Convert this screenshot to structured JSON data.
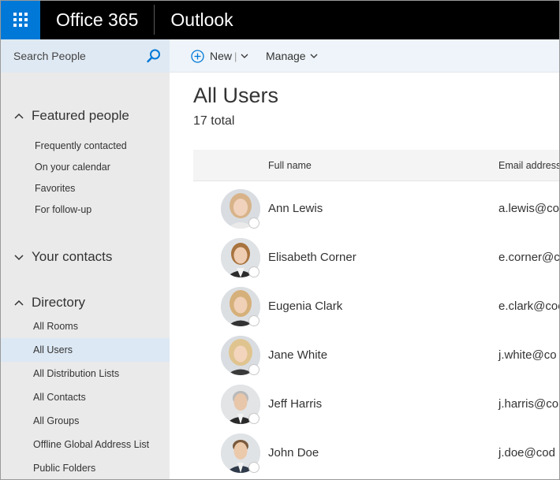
{
  "header": {
    "brand": "Office 365",
    "app": "Outlook"
  },
  "commandbar": {
    "search_placeholder": "Search People",
    "new_label": "New",
    "manage_label": "Manage"
  },
  "sidebar": {
    "featured_header": "Featured people",
    "featured_items": [
      "Frequently contacted",
      "On your calendar",
      "Favorites",
      "For follow-up"
    ],
    "contacts_header": "Your contacts",
    "directory_header": "Directory",
    "directory_items": [
      "All Rooms",
      "All Users",
      "All Distribution Lists",
      "All Contacts",
      "All Groups",
      "Offline Global Address List",
      "Public Folders"
    ],
    "selected_item": "All Users"
  },
  "main": {
    "title": "All Users",
    "total": "17 total",
    "columns": {
      "name": "Full name",
      "email": "Email address"
    },
    "rows": [
      {
        "name": "Ann Lewis",
        "email": "a.lewis@co"
      },
      {
        "name": "Elisabeth Corner",
        "email": "e.corner@c"
      },
      {
        "name": "Eugenia Clark",
        "email": "e.clark@coo"
      },
      {
        "name": "Jane White",
        "email": "j.white@co"
      },
      {
        "name": "Jeff Harris",
        "email": "j.harris@co"
      },
      {
        "name": "John Doe",
        "email": "j.doe@cod"
      }
    ]
  },
  "colors": {
    "accent": "#0078d7",
    "topbar": "#000000",
    "sidebar": "#eaeaea",
    "selected": "#dce8f4"
  }
}
